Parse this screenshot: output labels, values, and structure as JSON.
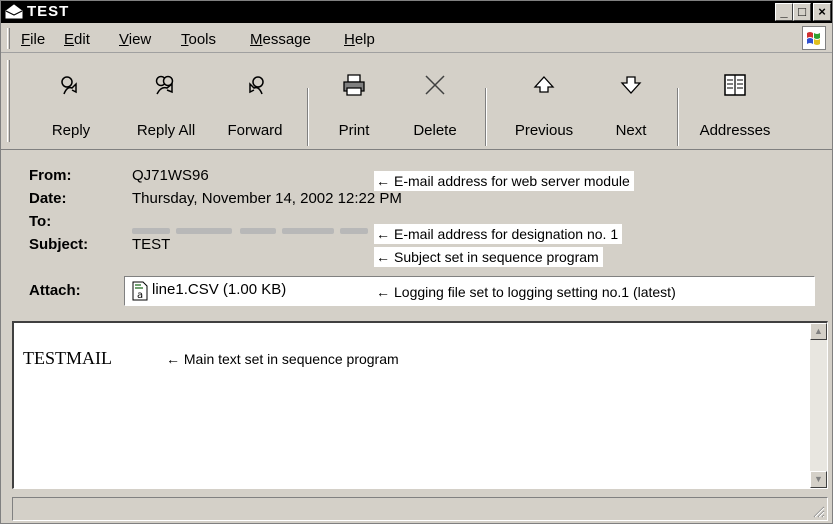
{
  "window": {
    "title": "TEST",
    "minimize": "_",
    "maximize": "□",
    "close": "×"
  },
  "menu": [
    {
      "text": "File",
      "key": "F",
      "rest": "ile"
    },
    {
      "text": "Edit",
      "key": "E",
      "rest": "dit"
    },
    {
      "text": "View",
      "key": "V",
      "rest": "iew"
    },
    {
      "text": "Tools",
      "key": "T",
      "rest": "ools"
    },
    {
      "text": "Message",
      "key": "M",
      "rest": "essage"
    },
    {
      "text": "Help",
      "key": "H",
      "rest": "elp"
    }
  ],
  "toolbar": {
    "reply": "Reply",
    "reply_all": "Reply All",
    "forward": "Forward",
    "print": "Print",
    "delete": "Delete",
    "previous": "Previous",
    "next": "Next",
    "addresses": "Addresses"
  },
  "headers": {
    "from_label": "From:",
    "from_value": "QJ71WS96",
    "date_label": "Date:",
    "date_value": "Thursday, November 14, 2002 12:22 PM",
    "to_label": "To:",
    "subject_label": "Subject:",
    "subject_value": "TEST",
    "attach_label": "Attach:",
    "attach_file": "line1.CSV (1.00 KB)"
  },
  "annotations": {
    "arrow": "←",
    "from": "E-mail address for web server module",
    "to": "E-mail address for designation no. 1",
    "subject": "Subject set in sequence program",
    "attach": "Logging file set to logging setting no.1 (latest)",
    "body": "Main text set in sequence program"
  },
  "body": {
    "text": "TESTMAIL"
  },
  "icons": {
    "reply": "reply-icon",
    "reply_all": "reply-all-icon",
    "forward": "forward-icon",
    "print": "printer-icon",
    "delete": "delete-x-icon",
    "previous": "up-arrow-icon",
    "next": "down-arrow-icon",
    "addresses": "address-book-icon"
  }
}
